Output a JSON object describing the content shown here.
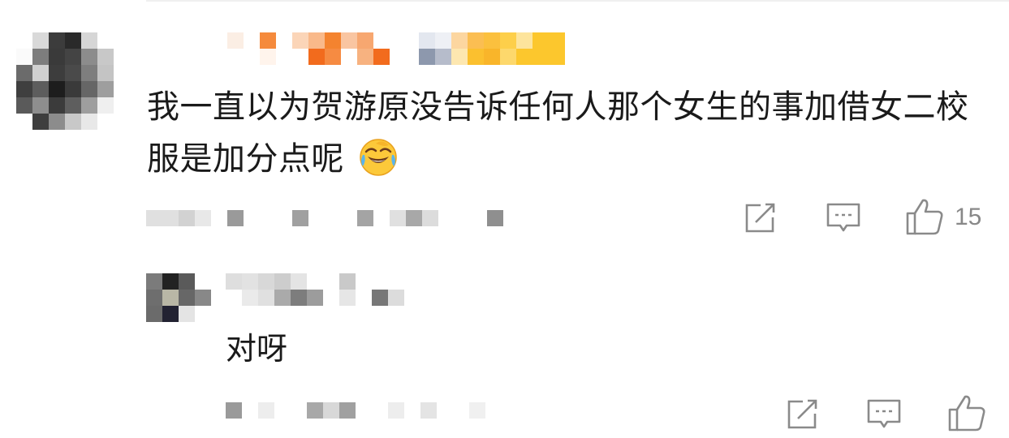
{
  "comments": [
    {
      "text": "我一直以为贺游原没告诉任何人那个女生的事加借女二校服是加分点呢",
      "emoji": "face-with-tears-of-joy-icon",
      "like_count": "15",
      "colors": {
        "name_accent": "#f26b1d",
        "badge": "#fcbf2d"
      }
    }
  ],
  "reply": {
    "text": "对呀"
  }
}
